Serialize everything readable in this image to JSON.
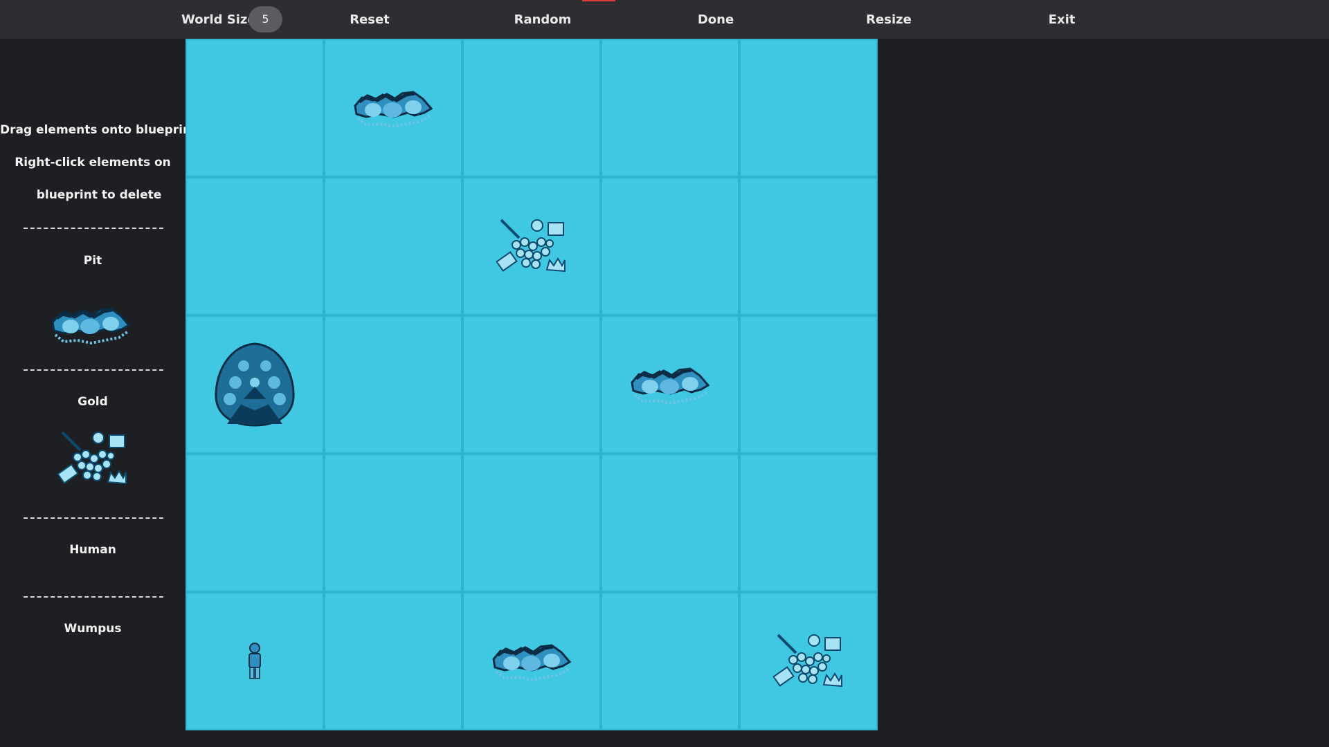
{
  "toolbar": {
    "world_size_label": "World Size",
    "world_size_value": "5",
    "reset_label": "Reset",
    "random_label": "Random",
    "done_label": "Done",
    "resize_label": "Resize",
    "exit_label": "Exit"
  },
  "sidebar": {
    "instruction_1": "Drag elements onto blueprint",
    "instruction_2": "Right-click elements on",
    "instruction_3": "blueprint to delete",
    "divider": "---------------------------",
    "items": [
      {
        "label": "Pit",
        "icon": "pit-icon"
      },
      {
        "label": "Gold",
        "icon": "gold-icon"
      },
      {
        "label": "Human",
        "icon": "human-icon"
      },
      {
        "label": "Wumpus",
        "icon": "wumpus-icon"
      }
    ]
  },
  "world": {
    "size": 5,
    "grid": [
      [
        "",
        "pit",
        "",
        "",
        ""
      ],
      [
        "",
        "",
        "gold",
        "",
        ""
      ],
      [
        "wumpus",
        "",
        "",
        "pit",
        ""
      ],
      [
        "",
        "",
        "",
        "",
        ""
      ],
      [
        "human",
        "",
        "pit",
        "",
        "gold"
      ]
    ]
  },
  "colors": {
    "background": "#1e1f22",
    "toolbar": "#2d2e31",
    "cell": "#40c8e2",
    "cell_border": "#2fb4cd",
    "sprite_dark": "#0d4a6e",
    "sprite_mid": "#2f8fbf",
    "sprite_light": "#a6e4f5"
  }
}
